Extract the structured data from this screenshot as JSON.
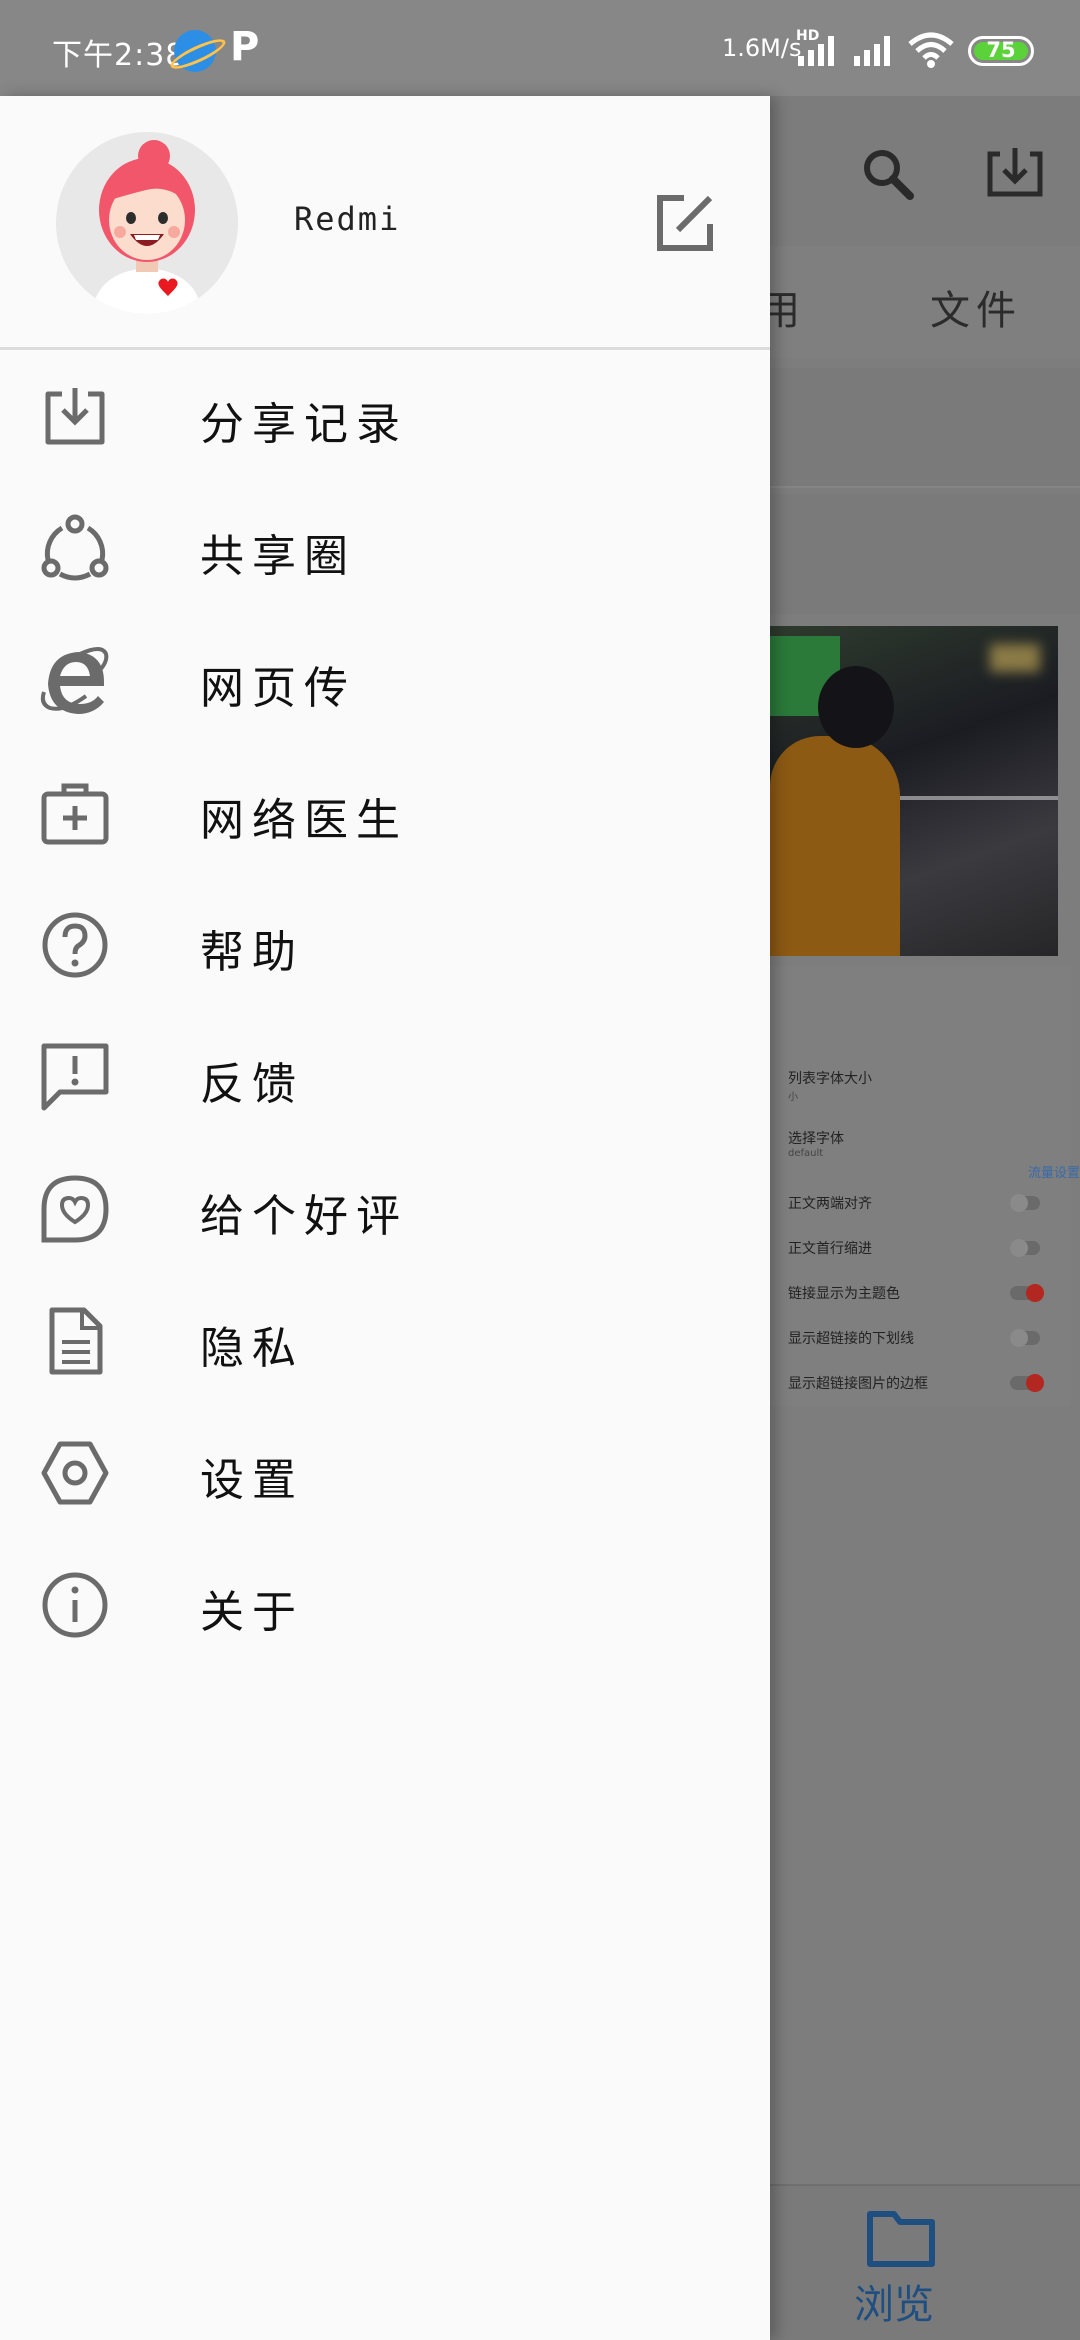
{
  "status_bar": {
    "time": "下午2:38",
    "network_speed": "1.6M/s",
    "signal_badge": "HD",
    "battery": "75"
  },
  "drawer": {
    "username": "Redmi",
    "menu": [
      {
        "label": "分享记录",
        "icon": "download-tray-icon"
      },
      {
        "label": "共享圈",
        "icon": "share-circle-icon"
      },
      {
        "label": "网页传",
        "icon": "ie-browser-icon"
      },
      {
        "label": "网络医生",
        "icon": "medical-kit-icon"
      },
      {
        "label": "帮助",
        "icon": "help-icon"
      },
      {
        "label": "反馈",
        "icon": "feedback-icon"
      },
      {
        "label": "给个好评",
        "icon": "heart-bubble-icon"
      },
      {
        "label": "隐私",
        "icon": "document-icon"
      },
      {
        "label": "设置",
        "icon": "hexagon-settings-icon"
      },
      {
        "label": "关于",
        "icon": "info-icon"
      }
    ]
  },
  "background_app": {
    "tab_partial": "用",
    "tab_files": "文件",
    "settings_rows": [
      {
        "label": "列表字体大小",
        "sub": "小"
      },
      {
        "label": "选择字体",
        "sub": "default"
      },
      {
        "label": "正文两端对齐",
        "state": "off"
      },
      {
        "label": "正文首行缩进",
        "state": "off"
      },
      {
        "label": "链接显示为主题色",
        "state": "on"
      },
      {
        "label": "显示超链接的下划线",
        "state": "off"
      },
      {
        "label": "显示超链接图片的边框",
        "state": "on"
      }
    ],
    "side_label": "流量设置",
    "bottom_nav_label": "浏览"
  },
  "colors": {
    "drawer_bg": "#fafafa",
    "icon_gray": "#6b6b6b",
    "scrim": "#7b7b7b",
    "toggle_on": "#b2271f",
    "battery_green": "#5bd13a"
  }
}
